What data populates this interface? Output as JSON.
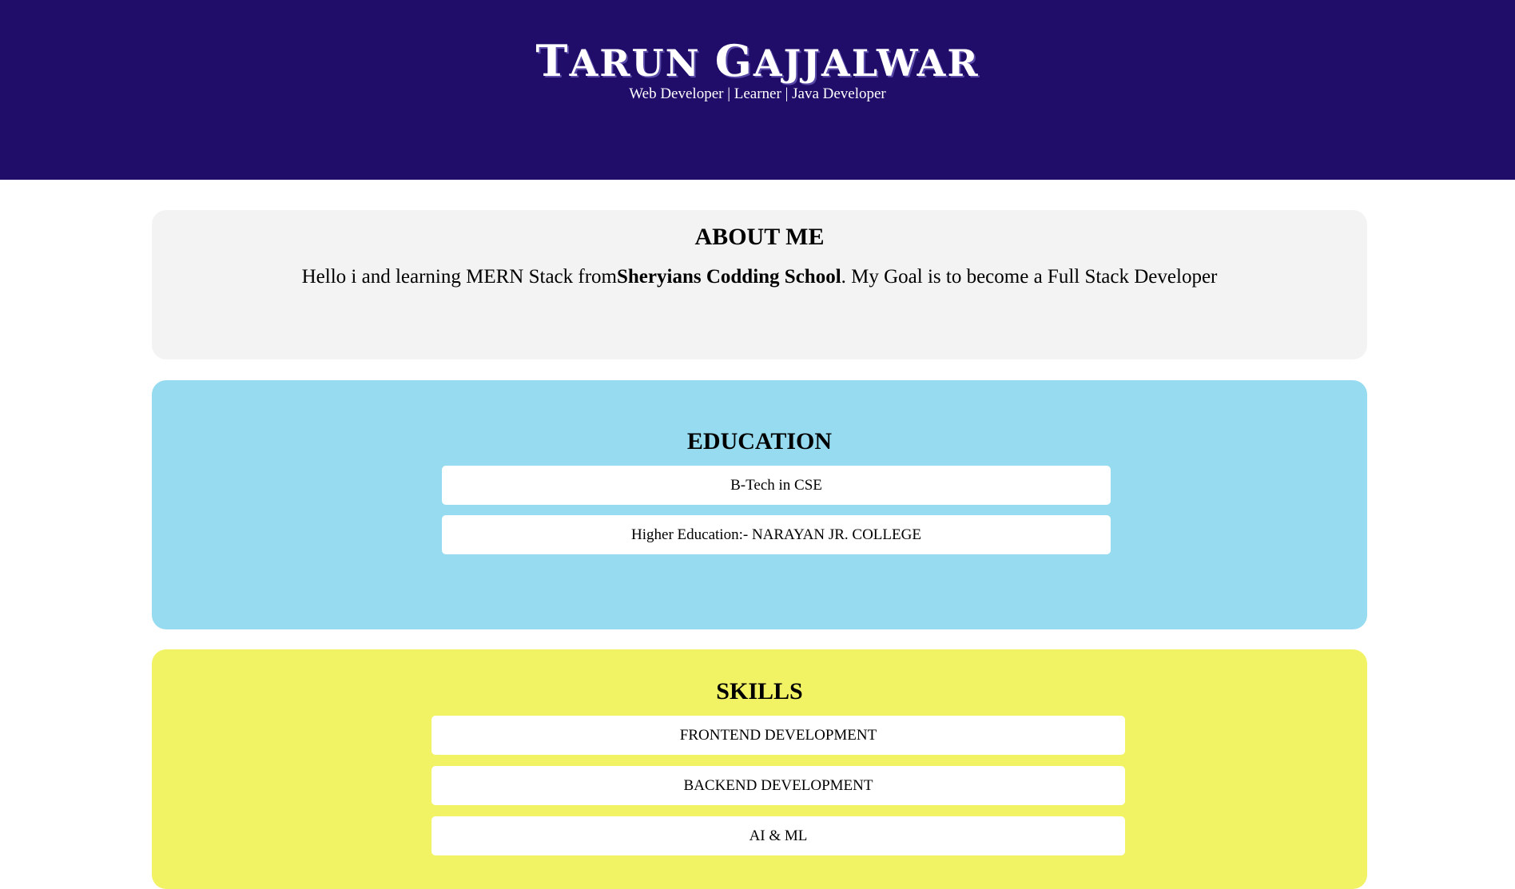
{
  "header": {
    "name_first_initial": "T",
    "name_first_rest": "arun ",
    "name_last_initial": "G",
    "name_last_rest": "ajjalwar",
    "tagline": "Web Developer | Learner | Java Developer"
  },
  "about": {
    "title": "ABOUT ME",
    "text_before": "Hello i and learning MERN Stack from",
    "school": "Sheryians Codding School",
    "text_after": ". My Goal is to become a Full Stack Developer"
  },
  "education": {
    "title": "EDUCATION",
    "items": [
      "B-Tech in CSE",
      "Higher Education:- NARAYAN JR. COLLEGE"
    ]
  },
  "skills": {
    "title": "SKILLS",
    "items": [
      "FRONTEND DEVELOPMENT",
      "BACKEND DEVELOPMENT",
      "AI & ML"
    ]
  },
  "colors": {
    "header_bg": "#200d69",
    "about_bg": "#f3f3f3",
    "education_bg": "#96dbf0",
    "skills_bg": "#f2f265"
  }
}
